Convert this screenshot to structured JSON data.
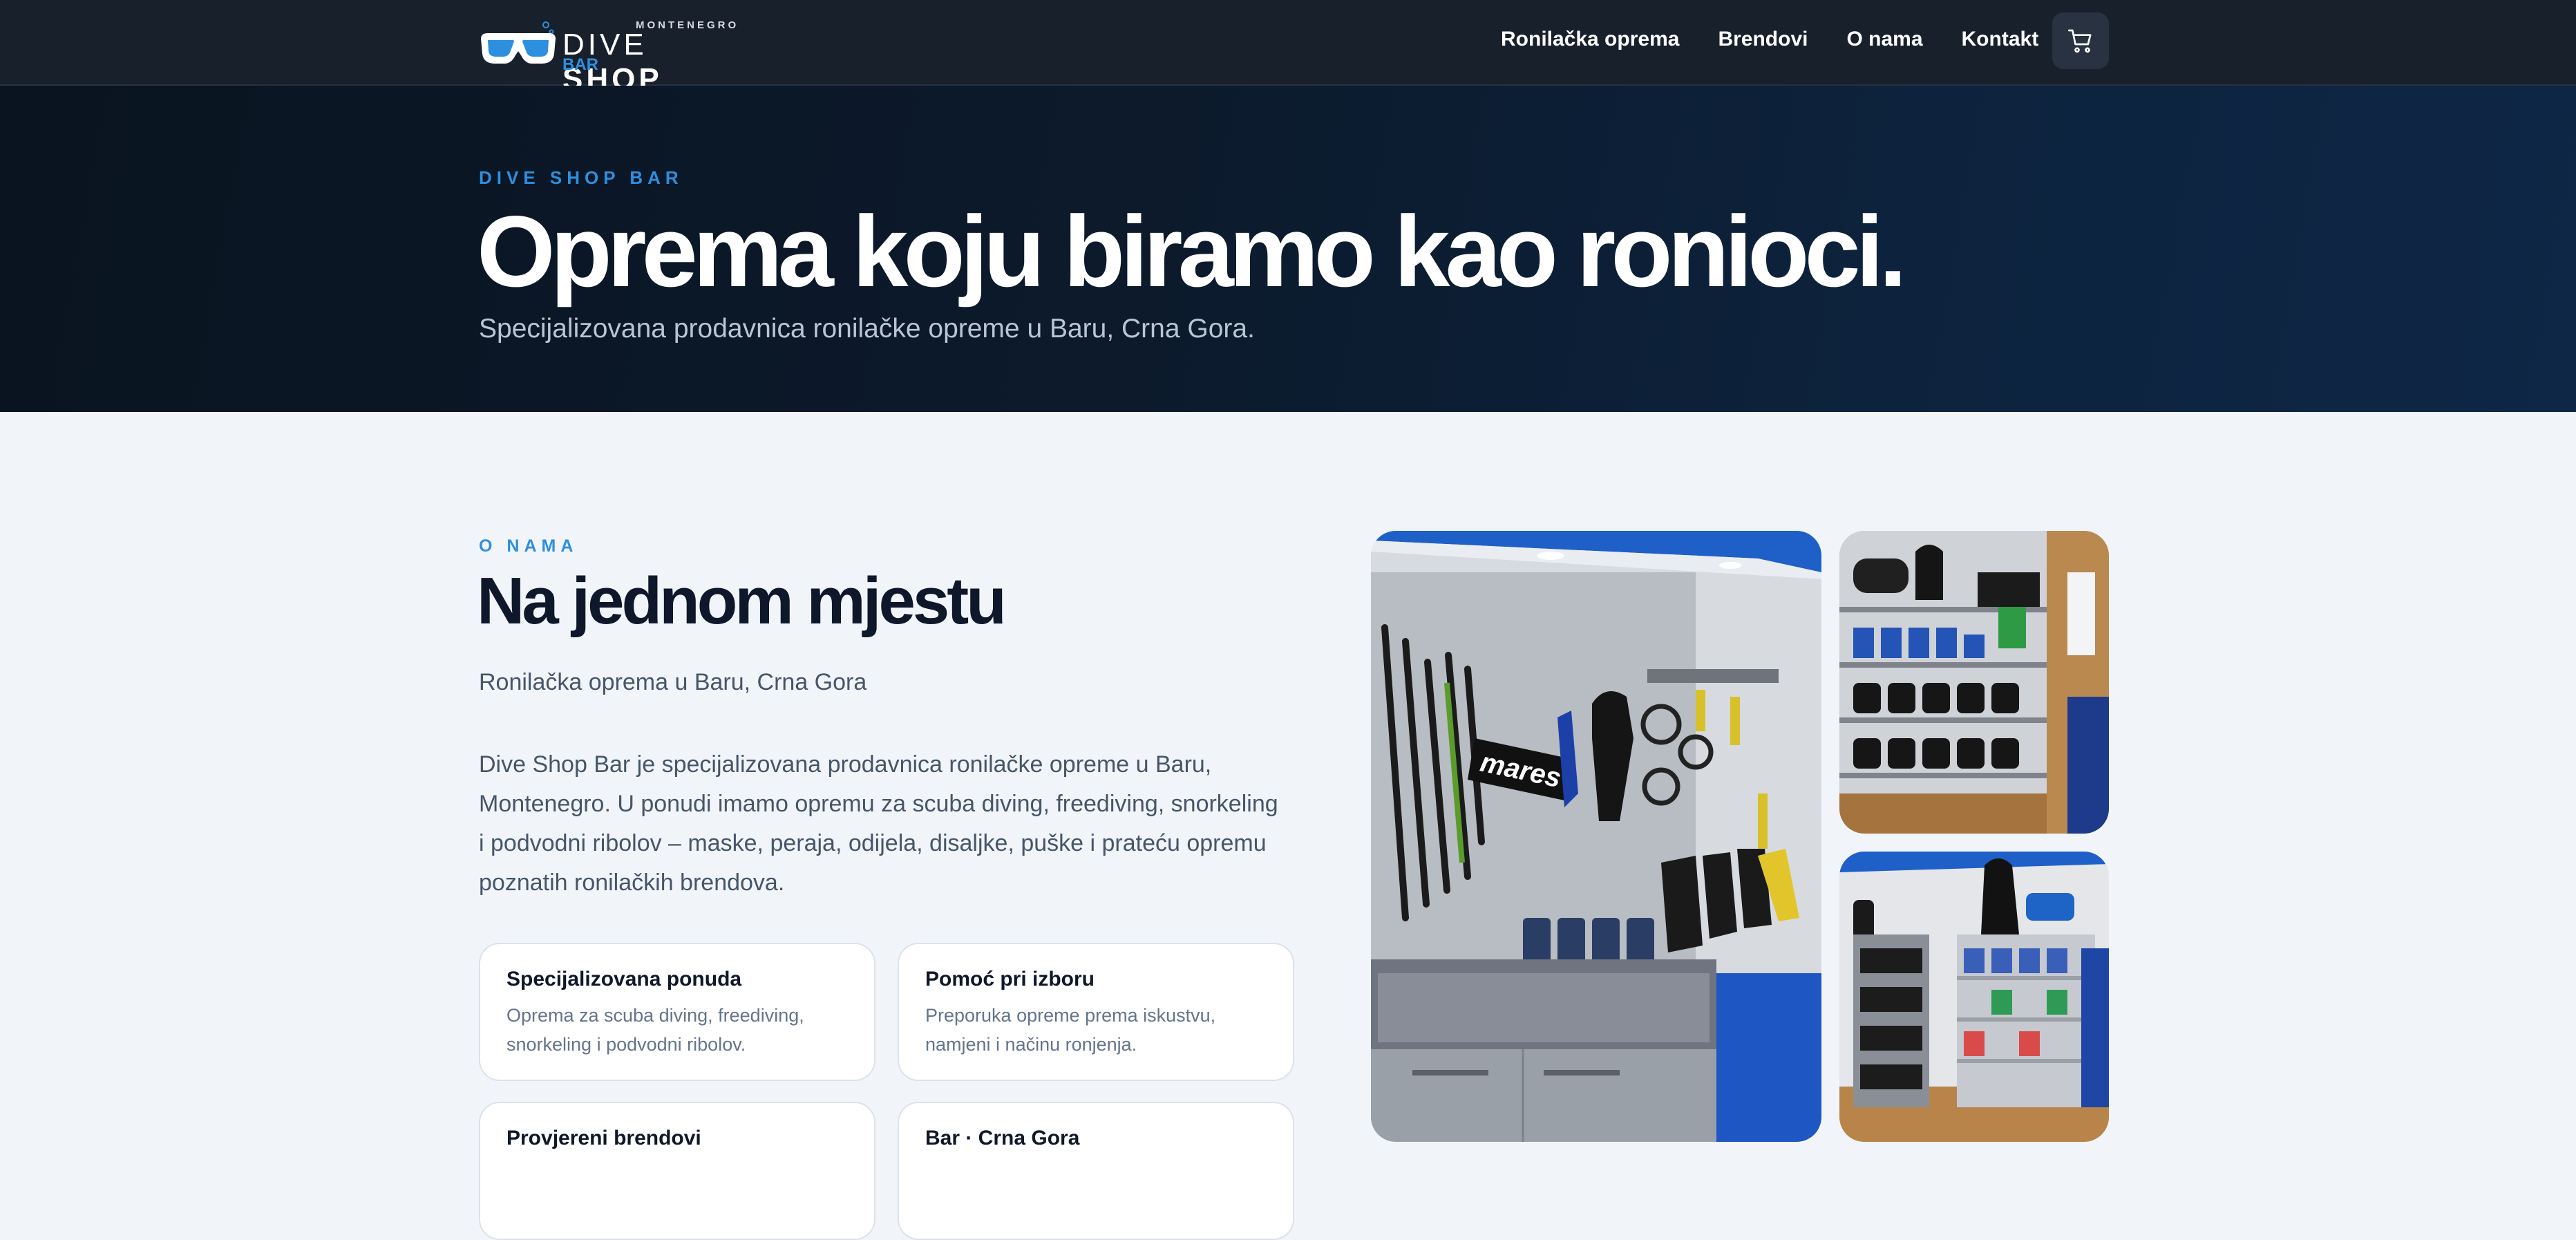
{
  "nav": {
    "logo": {
      "top": "MONTENEGRO",
      "main_light": "DIVE",
      "main_bold": "SHOP",
      "sub": "BAR",
      "icon": "dive-mask-icon"
    },
    "links": [
      "Ronilačka oprema",
      "Brendovi",
      "O nama",
      "Kontakt"
    ],
    "cart_icon": "cart-icon"
  },
  "hero": {
    "eyebrow": "DIVE SHOP BAR",
    "title": "Oprema koju biramo kao ronioci.",
    "subtitle": "Specijalizovana prodavnica ronilačke opreme u Baru, Crna Gora."
  },
  "about": {
    "eyebrow": "O NAMA",
    "title": "Na jednom mjestu",
    "subtitle": "Ronilačka oprema u Baru, Crna Gora",
    "body": "Dive Shop Bar je specijalizovana prodavnica ronilačke opreme u Baru, Montenegro. U ponudi imamo opremu za scuba diving, freediving, snorkeling i podvodni ribolov – maske, peraja, odijela, disaljke, puške i prateću opremu poznatih ronilačkih brendova.",
    "cards": [
      {
        "title": "Specijalizovana ponuda",
        "desc": "Oprema za scuba diving, freediving, snorkeling i podvodni ribolov."
      },
      {
        "title": "Pomoć pri izboru",
        "desc": "Preporuka opreme prema iskustvu, namjeni i načinu ronjenja."
      },
      {
        "title": "Provjereni brendovi",
        "desc": ""
      },
      {
        "title": "Bar · Crna Gora",
        "desc": ""
      }
    ]
  },
  "colors": {
    "accent": "#2d8fe0",
    "nav_bg": "#18202b",
    "hero_bg": "#0c1a2c",
    "page_bg": "#f1f5f9"
  }
}
